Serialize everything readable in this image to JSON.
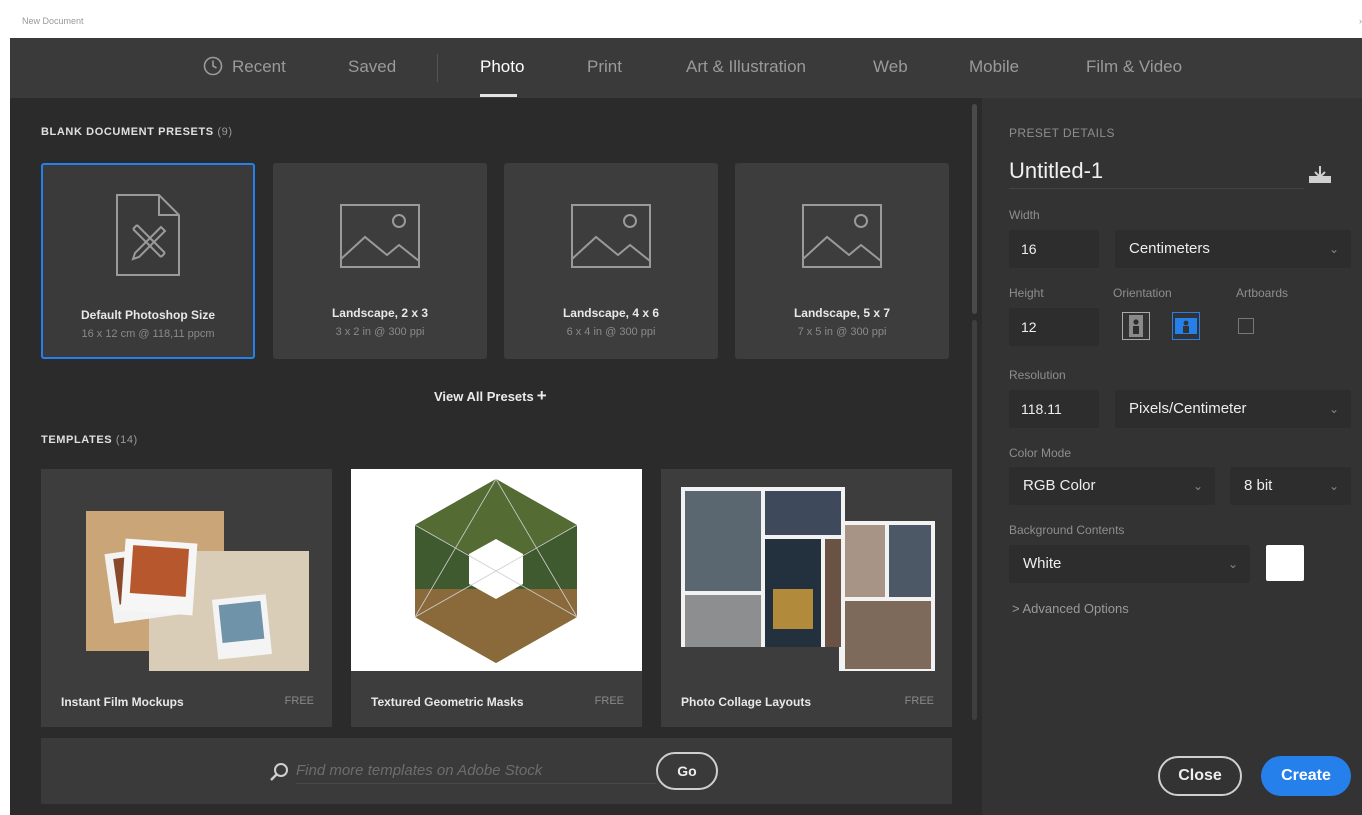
{
  "window": {
    "title": "New Document",
    "close_glyph": "›"
  },
  "tabs": [
    {
      "label": "Recent",
      "icon": "clock-icon"
    },
    {
      "label": "Saved"
    },
    {
      "label": "Photo",
      "active": true
    },
    {
      "label": "Print"
    },
    {
      "label": "Art & Illustration"
    },
    {
      "label": "Web"
    },
    {
      "label": "Mobile"
    },
    {
      "label": "Film & Video"
    }
  ],
  "blank_presets": {
    "title": "BLANK DOCUMENT PRESETS",
    "count": "(9)",
    "items": [
      {
        "name": "Default Photoshop Size",
        "size": "16 x 12 cm @ 118,11 ppcm",
        "icon": "document-edit-icon",
        "selected": true
      },
      {
        "name": "Landscape, 2 x 3",
        "size": "3 x 2 in @ 300 ppi",
        "icon": "image-placeholder-icon"
      },
      {
        "name": "Landscape, 4 x 6",
        "size": "6 x 4 in @ 300 ppi",
        "icon": "image-placeholder-icon"
      },
      {
        "name": "Landscape, 5 x 7",
        "size": "7 x 5 in @ 300 ppi",
        "icon": "image-placeholder-icon"
      }
    ],
    "view_all_label": "View All Presets",
    "view_all_glyph": "+"
  },
  "templates": {
    "title": "TEMPLATES",
    "count": "(14)",
    "items": [
      {
        "name": "Instant Film Mockups",
        "badge": "FREE"
      },
      {
        "name": "Textured Geometric Masks",
        "badge": "FREE"
      },
      {
        "name": "Photo Collage Layouts",
        "badge": "FREE"
      }
    ]
  },
  "search": {
    "placeholder": "Find more templates on Adobe Stock",
    "go_label": "Go"
  },
  "preset_details": {
    "title": "PRESET DETAILS",
    "doc_name": "Untitled-1",
    "width_label": "Width",
    "width_value": "16",
    "width_unit": "Centimeters",
    "height_label": "Height",
    "height_value": "12",
    "orientation_label": "Orientation",
    "orientation": "landscape",
    "artboards_label": "Artboards",
    "artboards_checked": false,
    "resolution_label": "Resolution",
    "resolution_value": "118.11",
    "resolution_unit": "Pixels/Centimeter",
    "color_mode_label": "Color Mode",
    "color_mode": "RGB Color",
    "bit_depth": "8 bit",
    "background_label": "Background Contents",
    "background": "White",
    "background_color": "#ffffff",
    "advanced_label": "Advanced Options",
    "advanced_glyph": ">"
  },
  "actions": {
    "close_label": "Close",
    "create_label": "Create"
  },
  "colors": {
    "accent": "#2680eb",
    "panel": "#333333",
    "main": "#2b2b2b",
    "tab_bar": "#3a3a3a"
  }
}
